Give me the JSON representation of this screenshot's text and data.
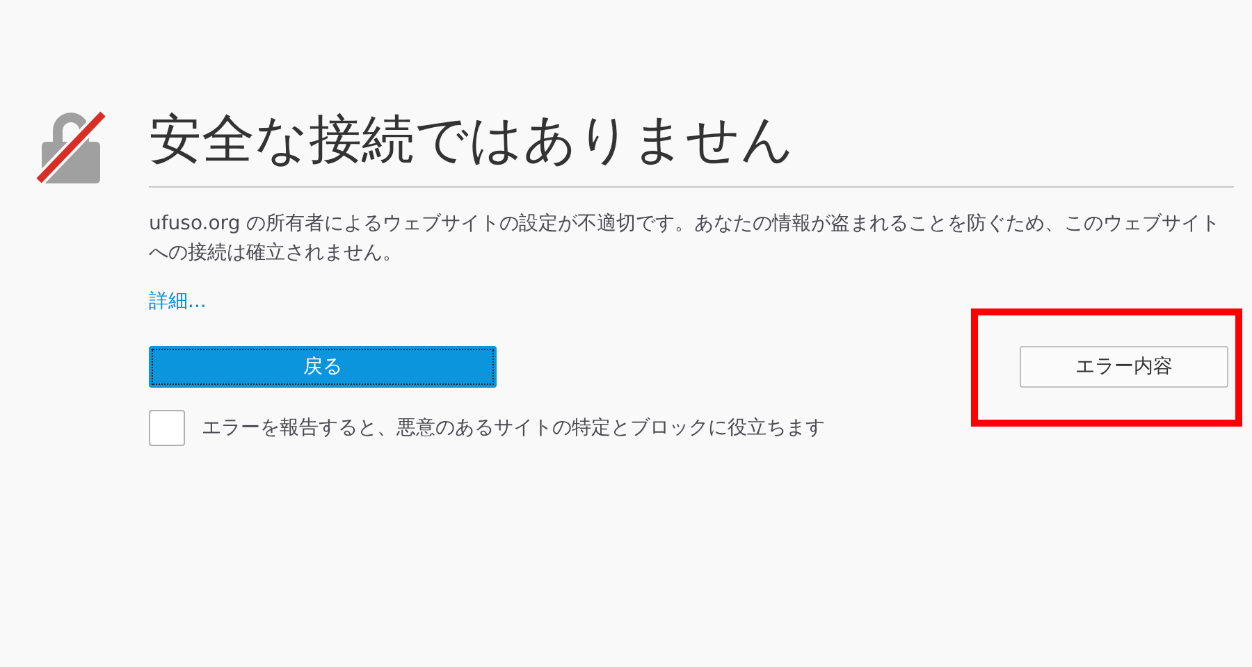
{
  "title": "安全な接続ではありません",
  "description": "ufuso.org の所有者によるウェブサイトの設定が不適切です。あなたの情報が盗まれることを防ぐため、このウェブサイトへの接続は確立されません。",
  "details_link": "詳細...",
  "buttons": [
    {
      "kind": "primary",
      "label": "戻る",
      "focused": true
    },
    {
      "kind": "secondary",
      "label": "エラー内容",
      "focused": false
    }
  ],
  "report_checkbox": {
    "label": "エラーを報告すると、悪意のあるサイトの特定とブロックに役立ちます",
    "checked": false
  }
}
